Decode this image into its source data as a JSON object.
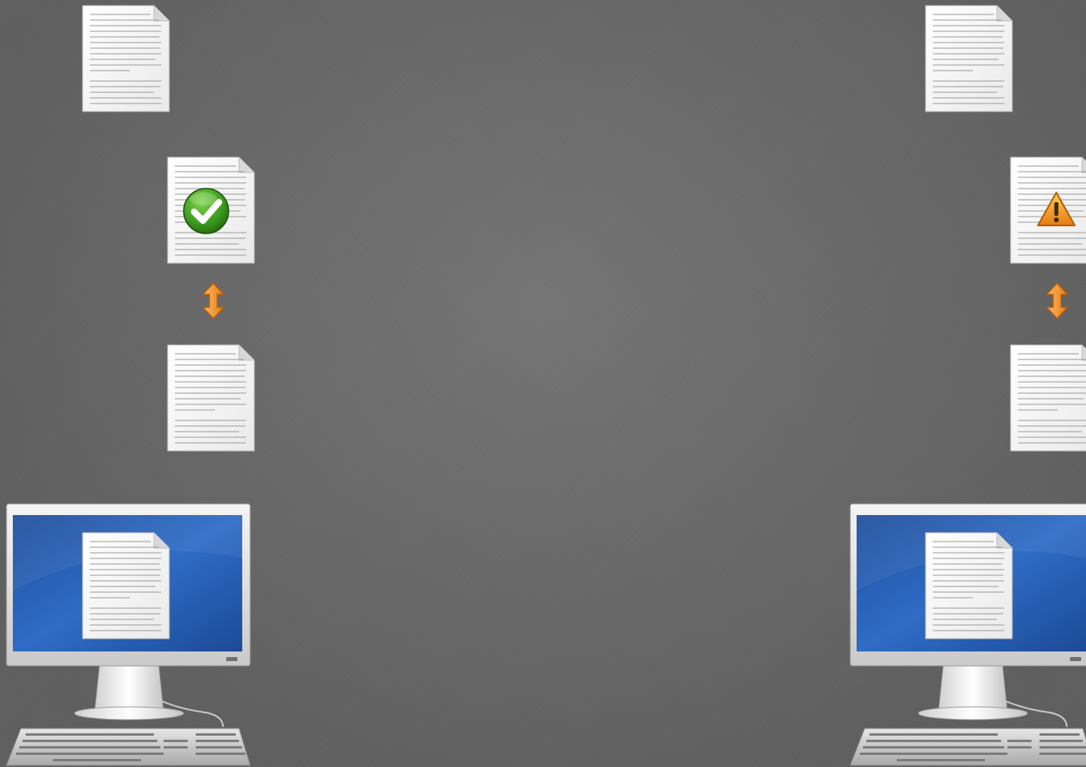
{
  "scene": {
    "background_color": "#6b6b6b",
    "left_group": {
      "status": "synced",
      "status_icon": "check-icon",
      "status_color": "#3c9a1e"
    },
    "right_group": {
      "status": "conflict",
      "status_icon": "warning-icon",
      "status_color": "#f0901a"
    },
    "arrow_icon": "up-down-arrow-icon",
    "arrow_color": "#f5932a",
    "document_icon": "document-icon",
    "computer_icon": "computer-icon",
    "screen_color": "#2a62b8"
  }
}
